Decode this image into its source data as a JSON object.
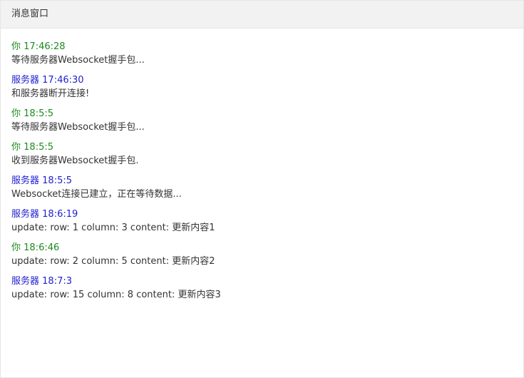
{
  "window": {
    "title": "消息窗口"
  },
  "colors": {
    "you": "#1e8a1e",
    "server": "#2020d0"
  },
  "messages": [
    {
      "sender": "你",
      "role": "you",
      "time": "17:46:28",
      "text": "等待服务器Websocket握手包..."
    },
    {
      "sender": "服务器",
      "role": "server",
      "time": "17:46:30",
      "text": "和服务器断开连接!"
    },
    {
      "sender": "你",
      "role": "you",
      "time": "18:5:5",
      "text": "等待服务器Websocket握手包..."
    },
    {
      "sender": "你",
      "role": "you",
      "time": "18:5:5",
      "text": "收到服务器Websocket握手包."
    },
    {
      "sender": "服务器",
      "role": "server",
      "time": "18:5:5",
      "text": "Websocket连接已建立，正在等待数据..."
    },
    {
      "sender": "服务器",
      "role": "server",
      "time": "18:6:19",
      "text": "update: row: 1 column: 3 content: 更新内容1"
    },
    {
      "sender": "你",
      "role": "you",
      "time": "18:6:46",
      "text": "update: row: 2 column: 5 content: 更新内容2"
    },
    {
      "sender": "服务器",
      "role": "server",
      "time": "18:7:3",
      "text": "update: row: 15 column: 8 content: 更新内容3"
    }
  ]
}
